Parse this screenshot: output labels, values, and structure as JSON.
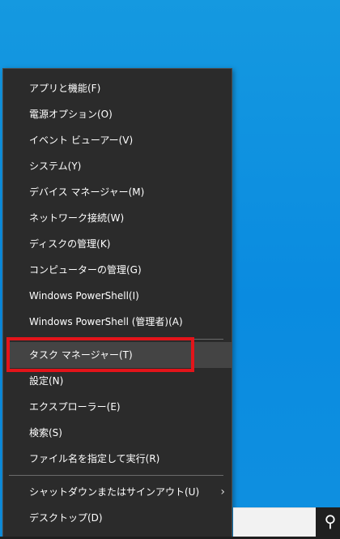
{
  "menu": {
    "items": [
      {
        "label": "アプリと機能(F)"
      },
      {
        "label": "電源オプション(O)"
      },
      {
        "label": "イベント ビューアー(V)"
      },
      {
        "label": "システム(Y)"
      },
      {
        "label": "デバイス マネージャー(M)"
      },
      {
        "label": "ネットワーク接続(W)"
      },
      {
        "label": "ディスクの管理(K)"
      },
      {
        "label": "コンピューターの管理(G)"
      },
      {
        "label": "Windows PowerShell(I)"
      },
      {
        "label": "Windows PowerShell (管理者)(A)"
      },
      {
        "label": "タスク マネージャー(T)"
      },
      {
        "label": "設定(N)"
      },
      {
        "label": "エクスプローラー(E)"
      },
      {
        "label": "検索(S)"
      },
      {
        "label": "ファイル名を指定して実行(R)"
      },
      {
        "label": "シャットダウンまたはサインアウト(U)",
        "submenu_icon": "chevron-right-icon"
      },
      {
        "label": "デスクトップ(D)"
      }
    ],
    "highlighted_item": "タスク マネージャー(T)",
    "highlight_color": "#e3141a",
    "hover_color": "#444444",
    "background_color": "#2b2b2b"
  },
  "taskbar": {
    "search_icon": "search-icon",
    "search_glyph": "⚲"
  },
  "desktop": {
    "background_color": "#0d8fd9"
  }
}
